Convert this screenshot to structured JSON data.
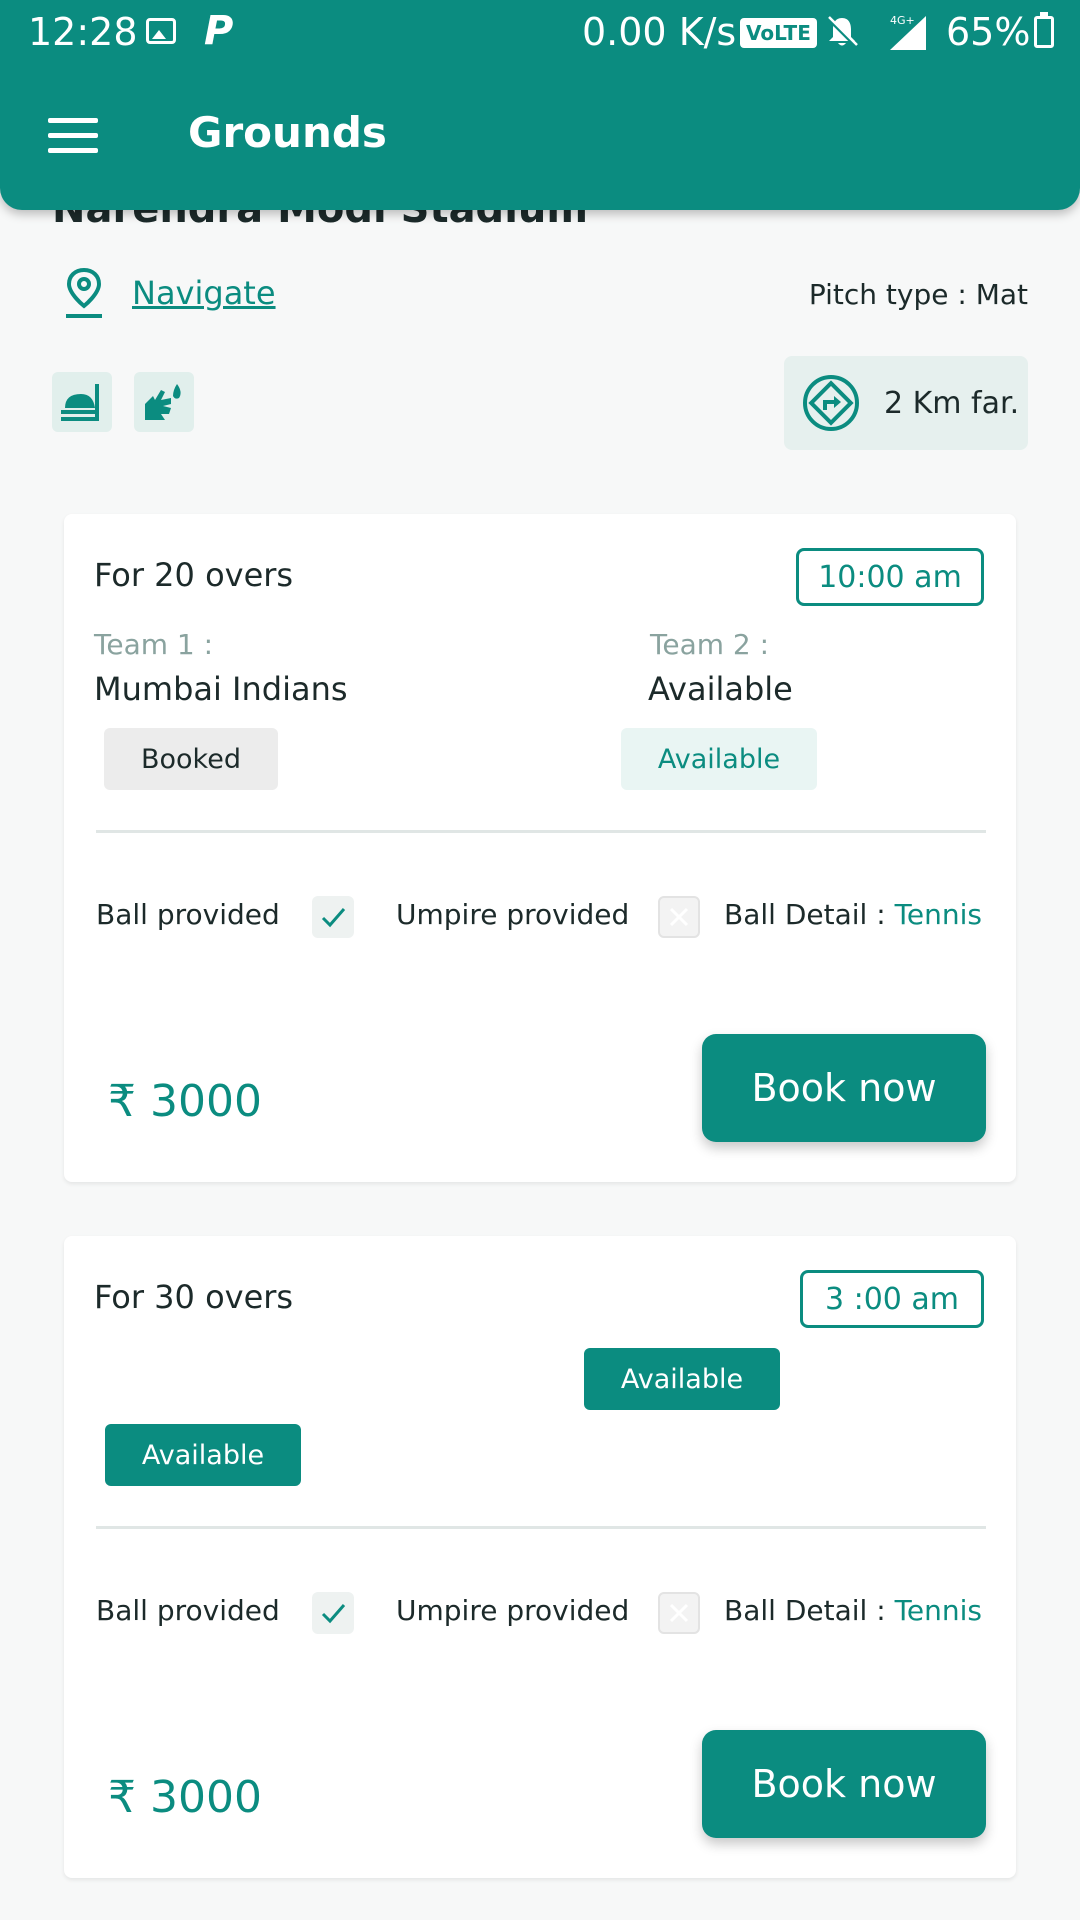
{
  "status_bar": {
    "time": "12:28",
    "net_speed": "0.00 K/s",
    "volte": "VoLTE",
    "network": "4G+",
    "battery": "65%"
  },
  "app_bar": {
    "title": "Grounds"
  },
  "ground": {
    "name": "Narendra Modi Stadium",
    "navigate_label": "Navigate",
    "pitch_type": "Pitch type : Mat",
    "distance": "2 Km far.",
    "facilities": [
      "food-icon",
      "hand-wash-icon"
    ]
  },
  "colors": {
    "primary": "#0b8c80",
    "background": "#f7f8f8"
  },
  "slots": [
    {
      "overs": "For 20 overs",
      "time": "10:00 am",
      "team1_label": "Team 1 :",
      "team1_name": "Mumbai Indians",
      "team1_status": "Booked",
      "team2_label": "Team 2 :",
      "team2_name": "Available",
      "team2_status": "Available",
      "ball_provided_label": "Ball provided",
      "ball_provided": true,
      "umpire_provided_label": "Umpire provided",
      "umpire_provided": false,
      "ball_detail_label": "Ball Detail : ",
      "ball_detail_value": "Tennis",
      "price": "₹ 3000",
      "book_label": "Book now"
    },
    {
      "overs": "For 30 overs",
      "time": "3 :00 am",
      "team1_status": "Available",
      "team2_status": "Available",
      "ball_provided_label": "Ball provided",
      "ball_provided": true,
      "umpire_provided_label": "Umpire provided",
      "umpire_provided": false,
      "ball_detail_label": "Ball Detail : ",
      "ball_detail_value": "Tennis",
      "price": "₹ 3000",
      "book_label": "Book now"
    }
  ]
}
